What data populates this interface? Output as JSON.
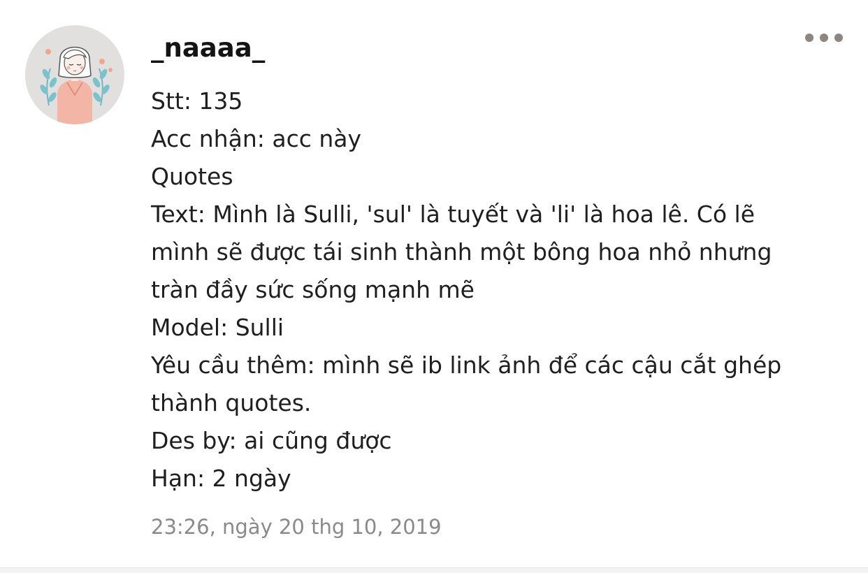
{
  "comment": {
    "author": "_naaaa_",
    "lines": [
      "Stt: 135",
      "Acc nhận: acc này",
      "Quotes",
      "Text: Mình là Sulli, 'sul' là tuyết và 'li' là hoa lê. Có lẽ",
      "mình sẽ được tái sinh thành một bông hoa nhỏ nhưng",
      "tràn đầy sức sống mạnh mẽ",
      "Model: Sulli",
      "Yêu cầu thêm: mình sẽ ib link ảnh để các cậu cắt ghép",
      "thành quotes.",
      "Des by: ai cũng được",
      "Hạn: 2 ngày"
    ],
    "timestamp": "23:26, ngày 20 thg 10, 2019"
  },
  "icons": {
    "avatar": "girl-illustration-avatar",
    "more": "more-horizontal-icon"
  },
  "colors": {
    "author": "#141414",
    "text": "#1f1f1f",
    "timestamp": "#8a8a8a",
    "more_dots": "#8d8580",
    "avatar_bg": "#e2e0df"
  }
}
